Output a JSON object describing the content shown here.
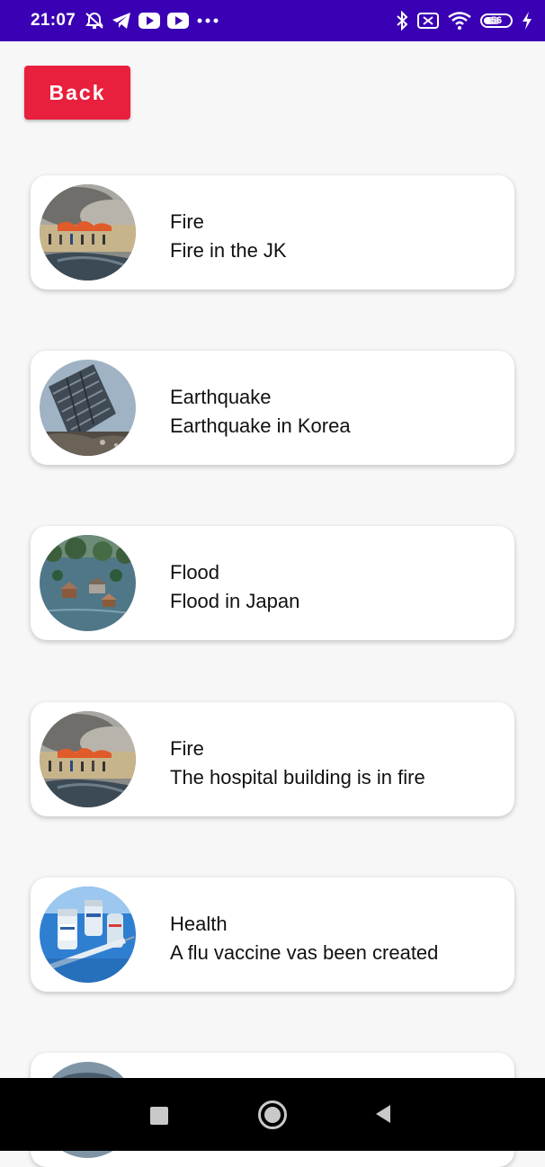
{
  "status_bar": {
    "time": "21:07",
    "left_icons": [
      "do-not-disturb-icon",
      "telegram-icon",
      "youtube-icon",
      "youtube-icon",
      "more-icon"
    ],
    "right_icons": [
      "bluetooth-icon",
      "sim-off-icon",
      "wifi-icon",
      "battery-icon",
      "charging-icon"
    ],
    "battery_level": "56",
    "background_color": "#3a00b4"
  },
  "back_button": {
    "label": "Back",
    "color": "#e8203d"
  },
  "news_items": [
    {
      "title": "Fire",
      "description": "Fire in the JK",
      "image": "fire-photo"
    },
    {
      "title": "Earthquake",
      "description": "Earthquake in Korea",
      "image": "earthquake-photo"
    },
    {
      "title": "Flood",
      "description": "Flood in Japan",
      "image": "flood-photo"
    },
    {
      "title": "Fire",
      "description": "The hospital building is in fire",
      "image": "fire-photo"
    },
    {
      "title": "Health",
      "description": "A flu vaccine vas been created",
      "image": "vaccine-photo"
    }
  ],
  "nav_bar": {
    "buttons": [
      "recents-square-icon",
      "home-circle-icon",
      "back-triangle-icon"
    ]
  }
}
